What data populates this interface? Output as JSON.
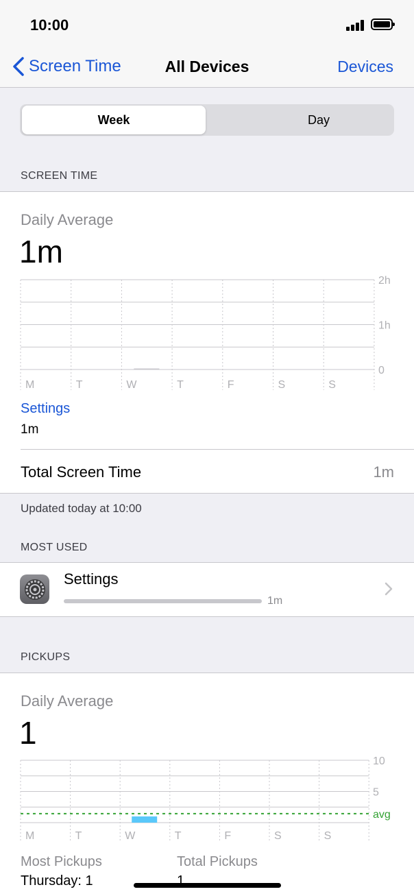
{
  "status_bar": {
    "time": "10:00"
  },
  "nav": {
    "back_label": "Screen Time",
    "title": "All Devices",
    "right_label": "Devices"
  },
  "segments": {
    "active": "Week",
    "other": "Day"
  },
  "screen_time": {
    "header": "SCREEN TIME",
    "avg_label": "Daily Average",
    "avg_value": "1m",
    "app_label": "Settings",
    "app_value": "1m",
    "total_label": "Total Screen Time",
    "total_value": "1m",
    "updated": "Updated today at 10:00"
  },
  "most_used": {
    "header": "MOST USED",
    "app_name": "Settings",
    "app_time": "1m",
    "usage_fraction": 1.0
  },
  "pickups": {
    "header": "PICKUPS",
    "avg_label": "Daily Average",
    "avg_value": "1",
    "most_label": "Most Pickups",
    "most_value": "Thursday: 1",
    "total_label": "Total Pickups",
    "total_value": "1"
  },
  "colors": {
    "accent": "#1a56d6",
    "pickup_bar": "#5ac8fa",
    "avg_line": "#34a334",
    "grid": "#c8c7cc"
  },
  "chart_data": [
    {
      "type": "bar",
      "categories": [
        "M",
        "T",
        "W",
        "T",
        "F",
        "S",
        "S"
      ],
      "values": [
        0,
        0,
        1,
        0,
        0,
        0,
        0
      ],
      "unit": "minutes",
      "y_ticks": [
        "2h",
        "1h",
        "0"
      ],
      "ylim": [
        0,
        120
      ]
    },
    {
      "type": "bar",
      "categories": [
        "M",
        "T",
        "W",
        "T",
        "F",
        "S",
        "S"
      ],
      "values": [
        0,
        0,
        1,
        0,
        0,
        0,
        0
      ],
      "y_ticks": [
        "10",
        "5"
      ],
      "ylim": [
        0,
        10
      ],
      "average": 1,
      "average_label": "avg"
    }
  ]
}
